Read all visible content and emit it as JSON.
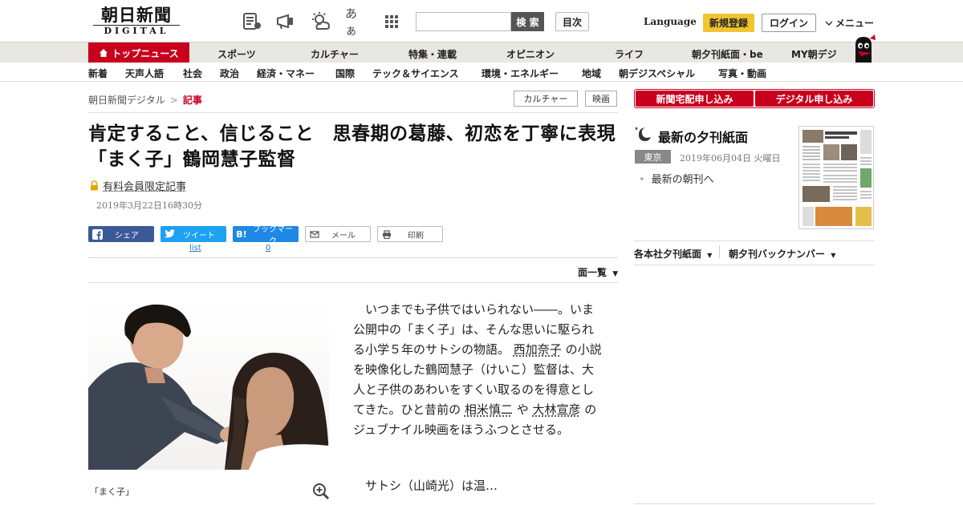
{
  "header": {
    "logo_jp": "朝日新聞",
    "logo_en": "DIGITAL",
    "icons": [
      "newspaper-icon",
      "megaphone-icon",
      "weather-icon",
      "font-size-icon",
      "grid-menu-icon"
    ],
    "font_icon_text": "あぁ",
    "search_placeholder": "",
    "search_button": "検 索",
    "toc_button": "目次",
    "language": "Language",
    "register": "新規登録",
    "login": "ログイン",
    "menu": "メニュー"
  },
  "nav_primary": {
    "top_news": "トップニュース",
    "items": [
      "スポーツ",
      "カルチャー",
      "特集・連載",
      "オピニオン",
      "ライフ",
      "朝夕刊紙面・be",
      "MY朝デジ"
    ]
  },
  "nav_secondary": {
    "items": [
      "新着",
      "天声人語",
      "社会",
      "政治",
      "経済・マネー",
      "国際",
      "テック＆サイエンス",
      "環境・エネルギー",
      "地域",
      "朝デジスペシャル",
      "写真・動画"
    ]
  },
  "breadcrumb": {
    "home": "朝日新聞デジタル",
    "separator": ">",
    "current": "記事"
  },
  "tags": [
    "カルチャー",
    "映画"
  ],
  "article": {
    "headline": "肯定すること、信じること　思春期の葛藤、初恋を丁寧に表現　「まく子」鶴岡慧子監督",
    "paid_label": "有料会員限定記事",
    "date": "2019年3月22日16時30分",
    "share": {
      "facebook": "シェア",
      "twitter": "ツイート",
      "twitter_count": "list",
      "hatena": "ブックマーク",
      "hatena_count": "0",
      "mail": "メール",
      "print": "印刷"
    },
    "page_list": "面一覧",
    "photo_caption": "「まく子」",
    "body_p1_a": "いつまでも子供ではいられない――。いま公開中の「まく子」は、そんな思いに駆られる小学５年のサトシの物語。",
    "link1": "西加奈子",
    "body_p1_b": "の小説を映像化した鶴岡慧子（けいこ）監督は、大人と子供のあわいをすくい取るのを得意としてきた。ひと昔前の",
    "link2": "相米慎二",
    "body_p1_c": "や",
    "link3": "大林宣彦",
    "body_p1_d": "のジュブナイル映画をほうふつとさせる。",
    "body_p2": "サトシ（山崎光）は温…"
  },
  "sidebar": {
    "subscribe_paper": "新聞宅配申し込み",
    "subscribe_digital": "デジタル申し込み",
    "evening_title": "最新の夕刊紙面",
    "location": "東京",
    "evening_date": "2019年06月04日 火曜日",
    "morning_link": "最新の朝刊へ",
    "links": [
      "各本社夕刊紙面",
      "朝夕刊バックナンバー"
    ]
  },
  "colors": {
    "brand_red": "#c8001e",
    "facebook": "#3b5998",
    "twitter": "#1da1f2",
    "hatena": "#1e88e5",
    "register": "#f2c42f"
  }
}
